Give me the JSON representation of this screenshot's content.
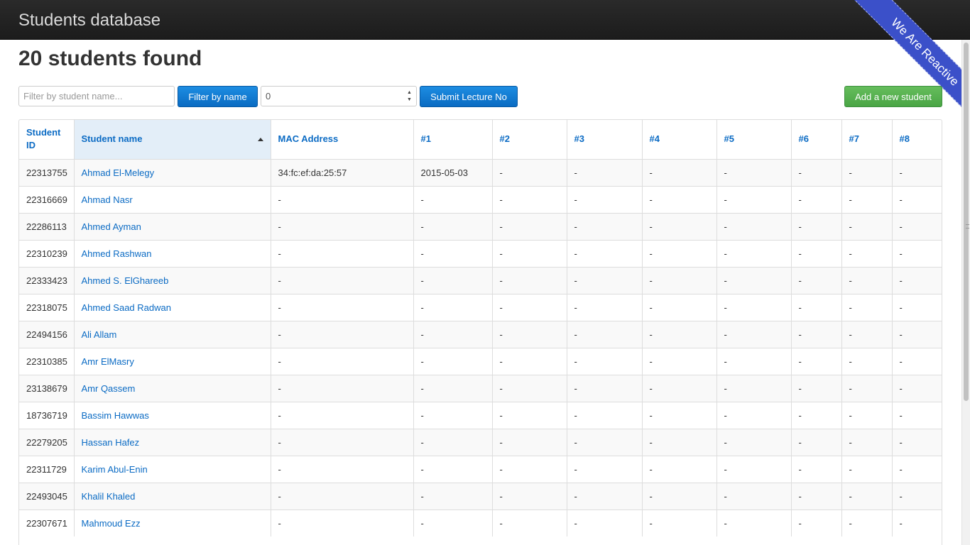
{
  "navbar": {
    "title": "Students database"
  },
  "ribbon": {
    "text": "We Are Reactive"
  },
  "heading": "20 students found",
  "toolbar": {
    "filter_placeholder": "Filter by student name...",
    "filter_button": "Filter by name",
    "lecture_value": "0",
    "submit_button": "Submit Lecture No",
    "add_button": "Add a new student"
  },
  "table": {
    "headers": [
      "Student ID",
      "Student name",
      "MAC Address",
      "#1",
      "#2",
      "#3",
      "#4",
      "#5",
      "#6",
      "#7",
      "#8"
    ],
    "rows": [
      [
        "22313755",
        "Ahmad El-Melegy",
        "34:fc:ef:da:25:57",
        "2015-05-03",
        "-",
        "-",
        "-",
        "-",
        "-",
        "-",
        "-"
      ],
      [
        "22316669",
        "Ahmad Nasr",
        "-",
        "-",
        "-",
        "-",
        "-",
        "-",
        "-",
        "-",
        "-"
      ],
      [
        "22286113",
        "Ahmed Ayman",
        "-",
        "-",
        "-",
        "-",
        "-",
        "-",
        "-",
        "-",
        "-"
      ],
      [
        "22310239",
        "Ahmed Rashwan",
        "-",
        "-",
        "-",
        "-",
        "-",
        "-",
        "-",
        "-",
        "-"
      ],
      [
        "22333423",
        "Ahmed S. ElGhareeb",
        "-",
        "-",
        "-",
        "-",
        "-",
        "-",
        "-",
        "-",
        "-"
      ],
      [
        "22318075",
        "Ahmed Saad Radwan",
        "-",
        "-",
        "-",
        "-",
        "-",
        "-",
        "-",
        "-",
        "-"
      ],
      [
        "22494156",
        "Ali Allam",
        "-",
        "-",
        "-",
        "-",
        "-",
        "-",
        "-",
        "-",
        "-"
      ],
      [
        "22310385",
        "Amr ElMasry",
        "-",
        "-",
        "-",
        "-",
        "-",
        "-",
        "-",
        "-",
        "-"
      ],
      [
        "23138679",
        "Amr Qassem",
        "-",
        "-",
        "-",
        "-",
        "-",
        "-",
        "-",
        "-",
        "-"
      ],
      [
        "18736719",
        "Bassim Hawwas",
        "-",
        "-",
        "-",
        "-",
        "-",
        "-",
        "-",
        "-",
        "-"
      ],
      [
        "22279205",
        "Hassan Hafez",
        "-",
        "-",
        "-",
        "-",
        "-",
        "-",
        "-",
        "-",
        "-"
      ],
      [
        "22311729",
        "Karim Abul-Enin",
        "-",
        "-",
        "-",
        "-",
        "-",
        "-",
        "-",
        "-",
        "-"
      ],
      [
        "22493045",
        "Khalil Khaled",
        "-",
        "-",
        "-",
        "-",
        "-",
        "-",
        "-",
        "-",
        "-"
      ],
      [
        "22307671",
        "Mahmoud Ezz",
        "-",
        "-",
        "-",
        "-",
        "-",
        "-",
        "-",
        "-",
        "-"
      ]
    ]
  },
  "colors": {
    "primary": "#0b6bc4",
    "success": "#5cb85c",
    "navbar": "#222222",
    "ribbon": "#3b50c9"
  },
  "icons": {
    "sort": "sort-ascending-icon",
    "spinner": "number-spinner-icon"
  }
}
